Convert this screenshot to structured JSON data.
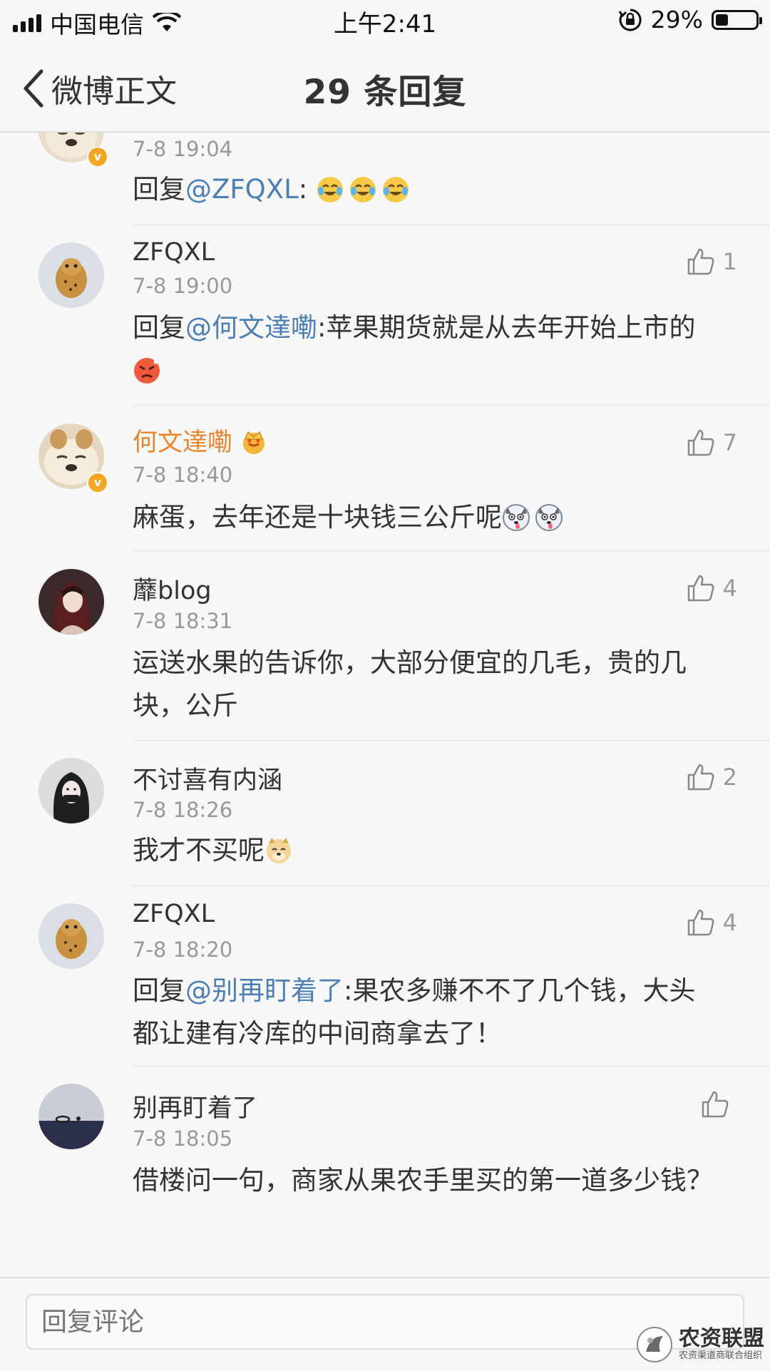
{
  "status_bar": {
    "carrier": "中国电信",
    "time": "上午2:41",
    "battery_percent": "29%",
    "battery_level": 0.29
  },
  "nav": {
    "back_label": "微博正文",
    "title": "29 条回复"
  },
  "comments": [
    {
      "username": "",
      "time": "7-8 19:04",
      "prefix": "回复",
      "mention": "@ZFQXL",
      "text": ":",
      "emojis": [
        "laugh-cry-emoji",
        "laugh-cry-emoji",
        "laugh-cry-emoji"
      ],
      "likes": ""
    },
    {
      "username": "ZFQXL",
      "time": "7-8 19:00",
      "prefix": "回复",
      "mention": "@何文達嘞",
      "text": ":苹果期货就是从去年开始上市的",
      "emojis": [
        "angry-emoji"
      ],
      "likes": "1"
    },
    {
      "username": "何文達嘞",
      "time": "7-8 18:40",
      "text": "麻蛋，去年还是十块钱三公斤呢",
      "emojis": [
        "husky-emoji",
        "husky-emoji"
      ],
      "likes": "7"
    },
    {
      "username": "蘼blog",
      "time": "7-8 18:31",
      "text": "运送水果的告诉你，大部分便宜的几毛，贵的几块，公斤",
      "likes": "4"
    },
    {
      "username": "不讨喜有内涵",
      "time": "7-8 18:26",
      "text": "我才不买呢",
      "emojis": [
        "doge-emoji"
      ],
      "likes": "2"
    },
    {
      "username": "ZFQXL",
      "time": "7-8 18:20",
      "prefix": "回复",
      "mention": "@别再盯着了",
      "text": ":果农多赚不不了几个钱，大头都让建有冷库的中间商拿去了！",
      "likes": "4"
    },
    {
      "username": "别再盯着了",
      "time": "7-8 18:05",
      "text": "借楼问一句，商家从果农手里买的第一道多少钱？",
      "likes": ""
    }
  ],
  "reply_bar": {
    "placeholder": "回复评论"
  },
  "watermark": {
    "title": "农资联盟",
    "subtitle": "农资渠道商联合组织"
  },
  "colors": {
    "mention": "#4c7fb3",
    "vip_name": "#e8852c",
    "verified_badge": "#f5a623",
    "meta": "#999999"
  }
}
